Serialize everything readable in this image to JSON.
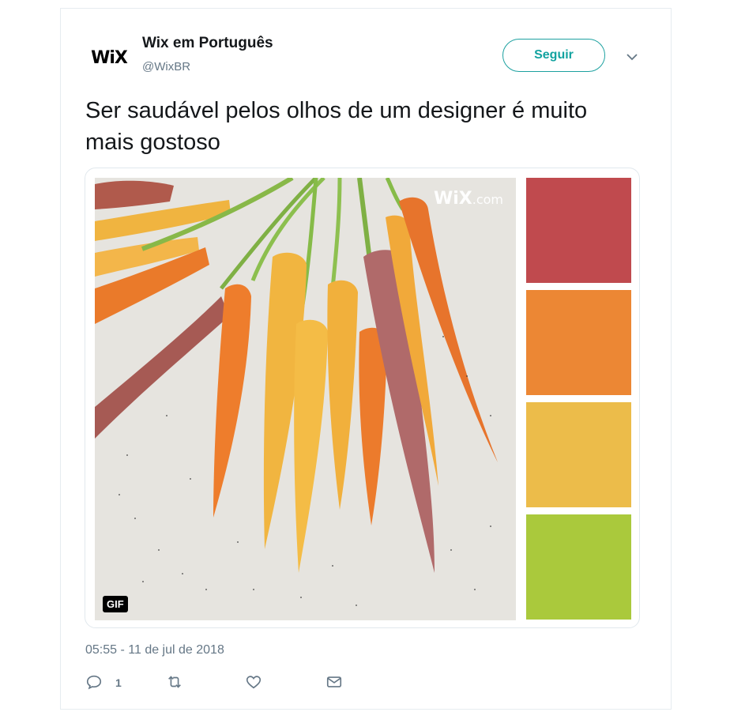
{
  "author": {
    "avatar_text": "WiX",
    "name": "Wix em Português",
    "handle": "@WixBR"
  },
  "follow_label": "Seguir",
  "tweet_text": "Ser saudável pelos olhos de um designer é muito mais gostoso",
  "media": {
    "watermark_main": "WiX",
    "watermark_suffix": ".com",
    "badge": "GIF",
    "palette": [
      "#c04a4e",
      "#ec8734",
      "#ecbc4a",
      "#aac93c"
    ]
  },
  "timestamp": "05:55 - 11 de jul de 2018",
  "actions": {
    "reply_count": "1"
  },
  "colors": {
    "accent": "#1da1a0",
    "muted": "#657786"
  }
}
